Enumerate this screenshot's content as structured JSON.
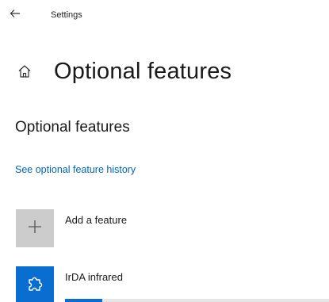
{
  "window": {
    "title": "Settings"
  },
  "header": {
    "title": "Optional features"
  },
  "section": {
    "title": "Optional features",
    "history_link": "See optional feature history"
  },
  "add_feature": {
    "label": "Add a feature",
    "icon": "plus-icon"
  },
  "installing_features": [
    {
      "name": "IrDA infrared",
      "icon": "puzzle-piece-icon",
      "progress": 0.14
    }
  ],
  "colors": {
    "accent": "#0a6ed1",
    "link": "#0066b4",
    "add_tile": "#cccccc"
  }
}
